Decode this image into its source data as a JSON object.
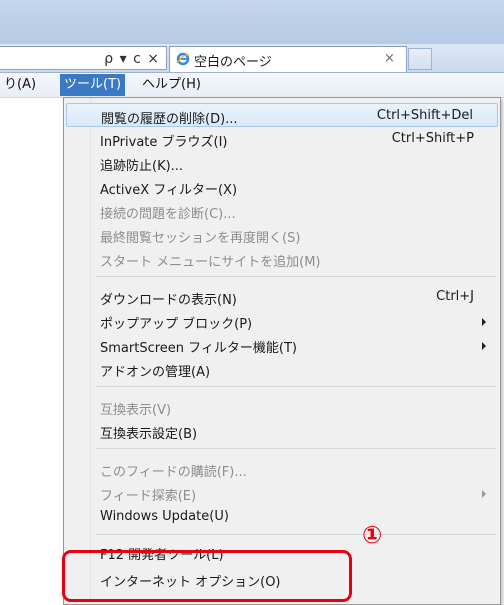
{
  "tab": {
    "title": "空白のページ",
    "close": "×"
  },
  "address_tools": "ρ ▾ c ×",
  "menubar": {
    "favorites": "り(A)",
    "tools": "ツール(T)",
    "help": "ヘルプ(H)"
  },
  "menu": {
    "delete_history": "閲覧の履歴の削除(D)...",
    "delete_history_shortcut": "Ctrl+Shift+Del",
    "inprivate": "InPrivate ブラウズ(I)",
    "inprivate_shortcut": "Ctrl+Shift+P",
    "tracking": "追跡防止(K)...",
    "activex": "ActiveX フィルター(X)",
    "diagnose": "接続の問題を診断(C)...",
    "reopen": "最終閲覧セッションを再度開く(S)",
    "start_menu": "スタート メニューにサイトを追加(M)",
    "downloads": "ダウンロードの表示(N)",
    "downloads_shortcut": "Ctrl+J",
    "popup": "ポップアップ ブロック(P)",
    "smartscreen": "SmartScreen フィルター機能(T)",
    "addons": "アドオンの管理(A)",
    "compat_view": "互換表示(V)",
    "compat_settings": "互換表示設定(B)",
    "subscribe": "このフィードの購読(F)...",
    "feed_discovery": "フィード探索(E)",
    "windows_update": "Windows Update(U)",
    "f12": "F12 開発者ツール(L)",
    "internet_options": "インターネット オプション(O)"
  },
  "annotation": {
    "number": "①",
    "color": "#e60012"
  },
  "colors": {
    "highlight": "#3a79c4",
    "chrome": "#c5d6ec"
  }
}
